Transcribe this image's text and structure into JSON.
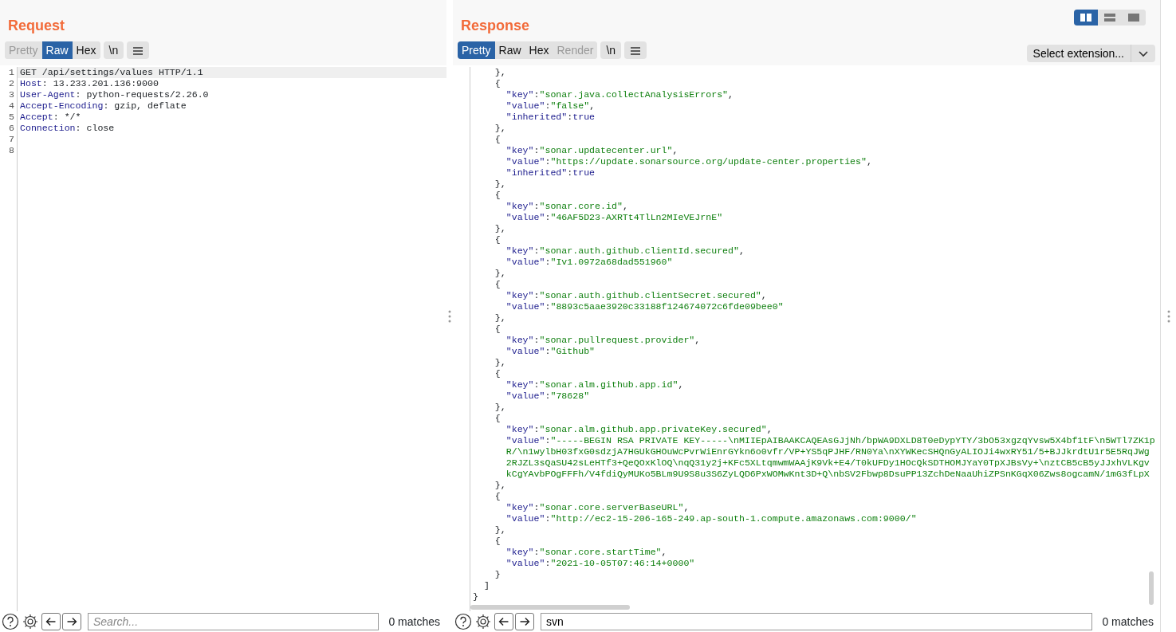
{
  "request": {
    "title": "Request",
    "tabs": [
      {
        "label": "Pretty",
        "selected": false,
        "disabled": true
      },
      {
        "label": "Raw",
        "selected": true,
        "disabled": false
      },
      {
        "label": "Hex",
        "selected": false,
        "disabled": false
      }
    ],
    "newline_button": "\\n",
    "lines": [
      {
        "number": "1",
        "current": true,
        "tokens": [
          {
            "kind": "plain",
            "text": "GET /api/settings/values HTTP/1.1"
          }
        ]
      },
      {
        "number": "2",
        "current": false,
        "tokens": [
          {
            "kind": "name",
            "text": "Host"
          },
          {
            "kind": "plain",
            "text": ": 13.233.201.136:9000"
          }
        ]
      },
      {
        "number": "3",
        "current": false,
        "tokens": [
          {
            "kind": "name",
            "text": "User-Agent"
          },
          {
            "kind": "plain",
            "text": ": python-requests/2.26.0"
          }
        ]
      },
      {
        "number": "4",
        "current": false,
        "tokens": [
          {
            "kind": "name",
            "text": "Accept-Encoding"
          },
          {
            "kind": "plain",
            "text": ": gzip, deflate"
          }
        ]
      },
      {
        "number": "5",
        "current": false,
        "tokens": [
          {
            "kind": "name",
            "text": "Accept"
          },
          {
            "kind": "plain",
            "text": ": */*"
          }
        ]
      },
      {
        "number": "6",
        "current": false,
        "tokens": [
          {
            "kind": "name",
            "text": "Connection"
          },
          {
            "kind": "plain",
            "text": ": close"
          }
        ]
      },
      {
        "number": "7",
        "current": false
      },
      {
        "number": "8",
        "current": false
      }
    ],
    "search": {
      "placeholder": "Search...",
      "matches": "0 matches"
    }
  },
  "response": {
    "title": "Response",
    "view_modes": [
      {
        "selected": true
      },
      {
        "selected": false
      },
      {
        "selected": false
      }
    ],
    "tabs": [
      {
        "label": "Pretty",
        "selected": true,
        "disabled": false
      },
      {
        "label": "Raw",
        "selected": false,
        "disabled": false
      },
      {
        "label": "Hex",
        "selected": false,
        "disabled": false
      },
      {
        "label": "Render",
        "selected": false,
        "disabled": true
      }
    ],
    "newline_button": "\\n",
    "extension_select": "Select extension...",
    "lines": [
      {
        "tokens": [
          {
            "kind": "punct",
            "text": "    },"
          }
        ]
      },
      {
        "tokens": [
          {
            "kind": "punct",
            "text": "    {"
          }
        ]
      },
      {
        "tokens": [
          {
            "kind": "key",
            "text": "      \"key\""
          },
          {
            "kind": "punct",
            "text": ":"
          },
          {
            "kind": "string",
            "text": "\"sonar.java.collectAnalysisErrors\""
          },
          {
            "kind": "punct",
            "text": ","
          }
        ]
      },
      {
        "tokens": [
          {
            "kind": "key",
            "text": "      \"value\""
          },
          {
            "kind": "punct",
            "text": ":"
          },
          {
            "kind": "string",
            "text": "\"false\""
          },
          {
            "kind": "punct",
            "text": ","
          }
        ]
      },
      {
        "tokens": [
          {
            "kind": "key",
            "text": "      \"inherited\""
          },
          {
            "kind": "punct",
            "text": ":"
          },
          {
            "kind": "literal",
            "text": "true"
          }
        ]
      },
      {
        "tokens": [
          {
            "kind": "punct",
            "text": "    },"
          }
        ]
      },
      {
        "tokens": [
          {
            "kind": "punct",
            "text": "    {"
          }
        ]
      },
      {
        "tokens": [
          {
            "kind": "key",
            "text": "      \"key\""
          },
          {
            "kind": "punct",
            "text": ":"
          },
          {
            "kind": "string",
            "text": "\"sonar.updatecenter.url\""
          },
          {
            "kind": "punct",
            "text": ","
          }
        ]
      },
      {
        "tokens": [
          {
            "kind": "key",
            "text": "      \"value\""
          },
          {
            "kind": "punct",
            "text": ":"
          },
          {
            "kind": "string",
            "text": "\"https://update.sonarsource.org/update-center.properties\""
          },
          {
            "kind": "punct",
            "text": ","
          }
        ]
      },
      {
        "tokens": [
          {
            "kind": "key",
            "text": "      \"inherited\""
          },
          {
            "kind": "punct",
            "text": ":"
          },
          {
            "kind": "literal",
            "text": "true"
          }
        ]
      },
      {
        "tokens": [
          {
            "kind": "punct",
            "text": "    },"
          }
        ]
      },
      {
        "tokens": [
          {
            "kind": "punct",
            "text": "    {"
          }
        ]
      },
      {
        "tokens": [
          {
            "kind": "key",
            "text": "      \"key\""
          },
          {
            "kind": "punct",
            "text": ":"
          },
          {
            "kind": "string",
            "text": "\"sonar.core.id\""
          },
          {
            "kind": "punct",
            "text": ","
          }
        ]
      },
      {
        "tokens": [
          {
            "kind": "key",
            "text": "      \"value\""
          },
          {
            "kind": "punct",
            "text": ":"
          },
          {
            "kind": "string",
            "text": "\"46AF5D23-AXRTt4TlLn2MIeVEJrnE\""
          }
        ]
      },
      {
        "tokens": [
          {
            "kind": "punct",
            "text": "    },"
          }
        ]
      },
      {
        "tokens": [
          {
            "kind": "punct",
            "text": "    {"
          }
        ]
      },
      {
        "tokens": [
          {
            "kind": "key",
            "text": "      \"key\""
          },
          {
            "kind": "punct",
            "text": ":"
          },
          {
            "kind": "string",
            "text": "\"sonar.auth.github.clientId.secured\""
          },
          {
            "kind": "punct",
            "text": ","
          }
        ]
      },
      {
        "tokens": [
          {
            "kind": "key",
            "text": "      \"value\""
          },
          {
            "kind": "punct",
            "text": ":"
          },
          {
            "kind": "string",
            "text": "\"Iv1.0972a68dad551960\""
          }
        ]
      },
      {
        "tokens": [
          {
            "kind": "punct",
            "text": "    },"
          }
        ]
      },
      {
        "tokens": [
          {
            "kind": "punct",
            "text": "    {"
          }
        ]
      },
      {
        "tokens": [
          {
            "kind": "key",
            "text": "      \"key\""
          },
          {
            "kind": "punct",
            "text": ":"
          },
          {
            "kind": "string",
            "text": "\"sonar.auth.github.clientSecret.secured\""
          },
          {
            "kind": "punct",
            "text": ","
          }
        ]
      },
      {
        "tokens": [
          {
            "kind": "key",
            "text": "      \"value\""
          },
          {
            "kind": "punct",
            "text": ":"
          },
          {
            "kind": "string",
            "text": "\"8893c5aae3920c33188f124674072c6fde09bee0\""
          }
        ]
      },
      {
        "tokens": [
          {
            "kind": "punct",
            "text": "    },"
          }
        ]
      },
      {
        "tokens": [
          {
            "kind": "punct",
            "text": "    {"
          }
        ]
      },
      {
        "tokens": [
          {
            "kind": "key",
            "text": "      \"key\""
          },
          {
            "kind": "punct",
            "text": ":"
          },
          {
            "kind": "string",
            "text": "\"sonar.pullrequest.provider\""
          },
          {
            "kind": "punct",
            "text": ","
          }
        ]
      },
      {
        "tokens": [
          {
            "kind": "key",
            "text": "      \"value\""
          },
          {
            "kind": "punct",
            "text": ":"
          },
          {
            "kind": "string",
            "text": "\"Github\""
          }
        ]
      },
      {
        "tokens": [
          {
            "kind": "punct",
            "text": "    },"
          }
        ]
      },
      {
        "tokens": [
          {
            "kind": "punct",
            "text": "    {"
          }
        ]
      },
      {
        "tokens": [
          {
            "kind": "key",
            "text": "      \"key\""
          },
          {
            "kind": "punct",
            "text": ":"
          },
          {
            "kind": "string",
            "text": "\"sonar.alm.github.app.id\""
          },
          {
            "kind": "punct",
            "text": ","
          }
        ]
      },
      {
        "tokens": [
          {
            "kind": "key",
            "text": "      \"value\""
          },
          {
            "kind": "punct",
            "text": ":"
          },
          {
            "kind": "string",
            "text": "\"78628\""
          }
        ]
      },
      {
        "tokens": [
          {
            "kind": "punct",
            "text": "    },"
          }
        ]
      },
      {
        "tokens": [
          {
            "kind": "punct",
            "text": "    {"
          }
        ]
      },
      {
        "tokens": [
          {
            "kind": "key",
            "text": "      \"key\""
          },
          {
            "kind": "punct",
            "text": ":"
          },
          {
            "kind": "string",
            "text": "\"sonar.alm.github.app.privateKey.secured\""
          },
          {
            "kind": "punct",
            "text": ","
          }
        ]
      },
      {
        "tokens": [
          {
            "kind": "key",
            "text": "      \"value\""
          },
          {
            "kind": "punct",
            "text": ":"
          },
          {
            "kind": "string",
            "text": "\"-----BEGIN RSA PRIVATE KEY-----\\nMIIEpAIBAAKCAQEAsGJjNh/bpWA9DXLD8T0eDypYTY/3bO53xgzqYvsw5X4bf1tF\\n5WTl7ZK1p"
          }
        ]
      },
      {
        "tokens": [
          {
            "kind": "string",
            "text": "      R/\\n1wylbH03fxG0sdzjA7HGUkGHOuWcPvrWiEnrGYkn6o0vfr/VP+YS5qPJHF/RN0Ya\\nXYWKecSHQnGyALIOJi4wxRY51/5+BJJkrdtU1r5E5RqJWg"
          }
        ]
      },
      {
        "tokens": [
          {
            "kind": "string",
            "text": "      2RJZL3sQaSU42sLeHTf3+QeQOxKlOQ\\nqQ31y2j+KFc5XLtqmwmWAAjK9Vk+E4/T0kUFDy1HOcQkSDTHOMJYaY0TpXJBsVy+\\nztCB5cB5yJJxhVLKgv"
          }
        ]
      },
      {
        "tokens": [
          {
            "kind": "string",
            "text": "      kCgYAvbPOgFFFh/V4fdiQyMUKo5BLm9U9S8u3S6ZyLQD6PxWOMwKnt3D+Q\\nbSV2Fbwp8DsuPP13ZchDeNaaUhiZPSnKGqX06Zws8ogcamN/1mG3fLpX"
          }
        ]
      },
      {
        "tokens": [
          {
            "kind": "punct",
            "text": "    },"
          }
        ]
      },
      {
        "tokens": [
          {
            "kind": "punct",
            "text": "    {"
          }
        ]
      },
      {
        "tokens": [
          {
            "kind": "key",
            "text": "      \"key\""
          },
          {
            "kind": "punct",
            "text": ":"
          },
          {
            "kind": "string",
            "text": "\"sonar.core.serverBaseURL\""
          },
          {
            "kind": "punct",
            "text": ","
          }
        ]
      },
      {
        "tokens": [
          {
            "kind": "key",
            "text": "      \"value\""
          },
          {
            "kind": "punct",
            "text": ":"
          },
          {
            "kind": "string",
            "text": "\"http://ec2-15-206-165-249.ap-south-1.compute.amazonaws.com:9000/\""
          }
        ]
      },
      {
        "tokens": [
          {
            "kind": "punct",
            "text": "    },"
          }
        ]
      },
      {
        "tokens": [
          {
            "kind": "punct",
            "text": "    {"
          }
        ]
      },
      {
        "tokens": [
          {
            "kind": "key",
            "text": "      \"key\""
          },
          {
            "kind": "punct",
            "text": ":"
          },
          {
            "kind": "string",
            "text": "\"sonar.core.startTime\""
          },
          {
            "kind": "punct",
            "text": ","
          }
        ]
      },
      {
        "tokens": [
          {
            "kind": "key",
            "text": "      \"value\""
          },
          {
            "kind": "punct",
            "text": ":"
          },
          {
            "kind": "string",
            "text": "\"2021-10-05T07:46:14+0000\""
          }
        ]
      },
      {
        "tokens": [
          {
            "kind": "punct",
            "text": "    }"
          }
        ]
      },
      {
        "tokens": [
          {
            "kind": "punct",
            "text": "  ]"
          }
        ]
      },
      {
        "tokens": [
          {
            "kind": "punct",
            "text": "}"
          }
        ]
      }
    ],
    "search": {
      "value": "svn",
      "matches": "0 matches"
    }
  }
}
